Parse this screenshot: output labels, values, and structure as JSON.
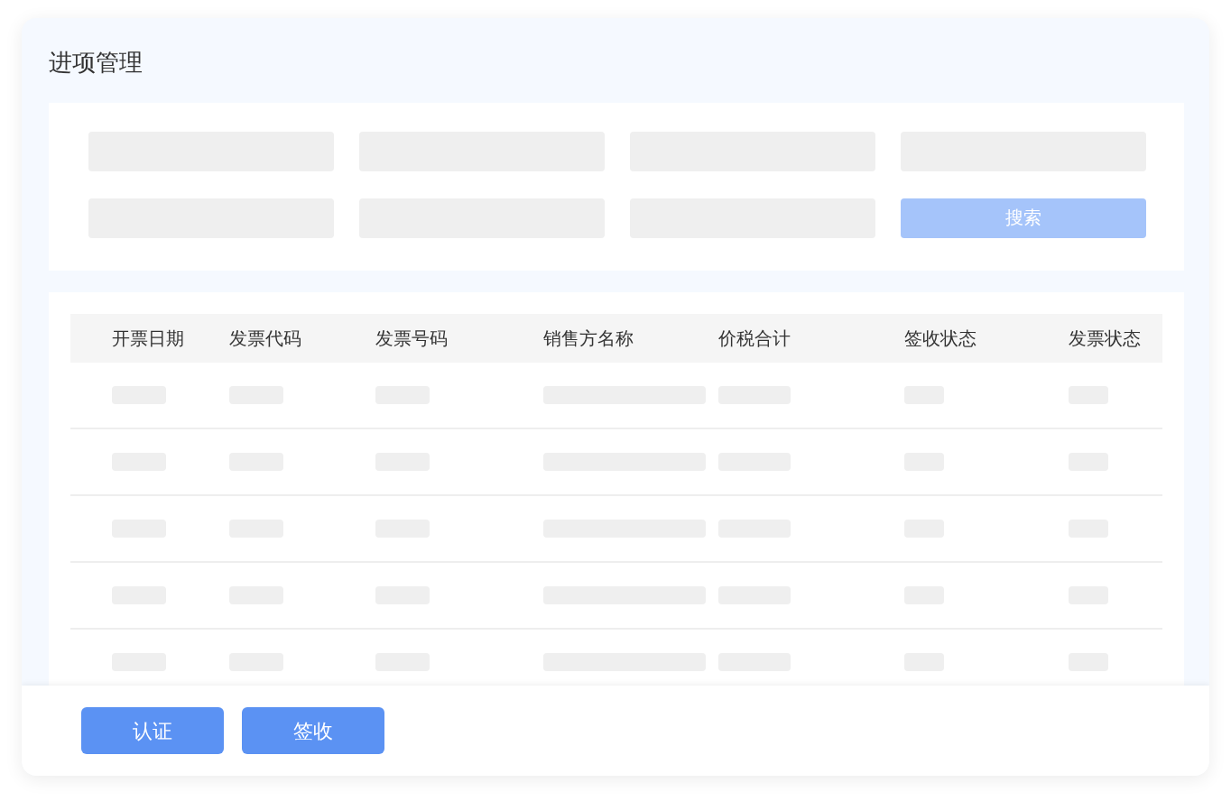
{
  "page": {
    "title": "进项管理"
  },
  "filter": {
    "search_button": {
      "label": "搜索",
      "disabled": true
    }
  },
  "table": {
    "columns": [
      "开票日期",
      "发票代码",
      "发票号码",
      "销售方名称",
      "价税合计",
      "签收状态",
      "发票状态"
    ]
  },
  "actions": [
    "认证",
    "签收"
  ]
}
